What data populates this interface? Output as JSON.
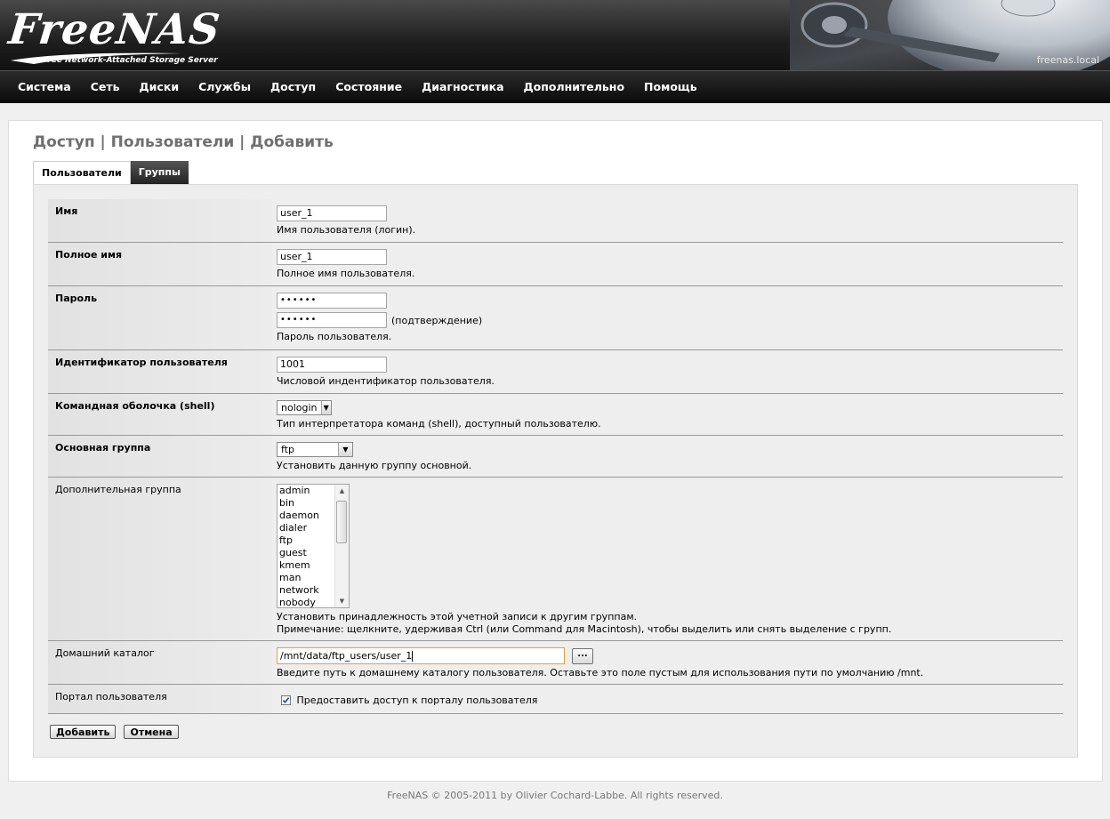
{
  "header": {
    "logo": "FreeNAS",
    "logo_subtitle": "Free Network-Attached Storage Server",
    "hostname": "freenas.local"
  },
  "nav": [
    "Система",
    "Сеть",
    "Диски",
    "Службы",
    "Доступ",
    "Состояние",
    "Диагностика",
    "Дополнительно",
    "Помощь"
  ],
  "page": {
    "title": "Доступ | Пользователи | Добавить",
    "tabs": [
      {
        "label": "Пользователи",
        "active": true
      },
      {
        "label": "Группы",
        "active": false
      }
    ]
  },
  "form": {
    "name": {
      "label": "Имя",
      "value": "user_1",
      "desc": "Имя пользователя (логин)."
    },
    "fullname": {
      "label": "Полное имя",
      "value": "user_1",
      "desc": "Полное имя пользователя."
    },
    "password": {
      "label": "Пароль",
      "value": "••••••",
      "confirm_value": "••••••",
      "confirm_note": "(подтверждение)",
      "desc": "Пароль пользователя."
    },
    "uid": {
      "label": "Идентификатор пользователя",
      "value": "1001",
      "desc": "Числовой индентификатор пользователя."
    },
    "shell": {
      "label": "Командная оболочка (shell)",
      "value": "nologin",
      "desc": "Тип интерпретатора команд (shell), доступный пользователю."
    },
    "primary_group": {
      "label": "Основная группа",
      "value": "ftp",
      "desc": "Установить данную группу основной."
    },
    "additional_groups": {
      "label": "Дополнительная группа",
      "options": [
        "admin",
        "bin",
        "daemon",
        "dialer",
        "ftp",
        "guest",
        "kmem",
        "man",
        "network",
        "nobody"
      ],
      "desc1": "Установить принадлежность этой учетной записи к другим группам.",
      "desc2": "Примечание: щелкните, удерживая Ctrl (или Command для Macintosh), чтобы выделить или снять выделение с групп."
    },
    "homedir": {
      "label": "Домашний каталог",
      "value": "/mnt/data/ftp_users/user_1",
      "browse_label": "...",
      "desc": "Введите путь к домашнему каталогу пользователя. Оставьте это поле пустым для использования пути по умолчанию /mnt."
    },
    "portal": {
      "label": "Портал пользователя",
      "checked": true,
      "checkbox_label": "Предоставить доступ к порталу пользователя"
    }
  },
  "buttons": {
    "add": "Добавить",
    "cancel": "Отмена"
  },
  "footer": "FreeNAS © 2005-2011 by Olivier Cochard-Labbe. All rights reserved.",
  "colors": {
    "nav_bg": "#111111",
    "panel_bg": "#eeeeee",
    "title": "#6f6f6f",
    "focus_border": "#e0a040"
  }
}
